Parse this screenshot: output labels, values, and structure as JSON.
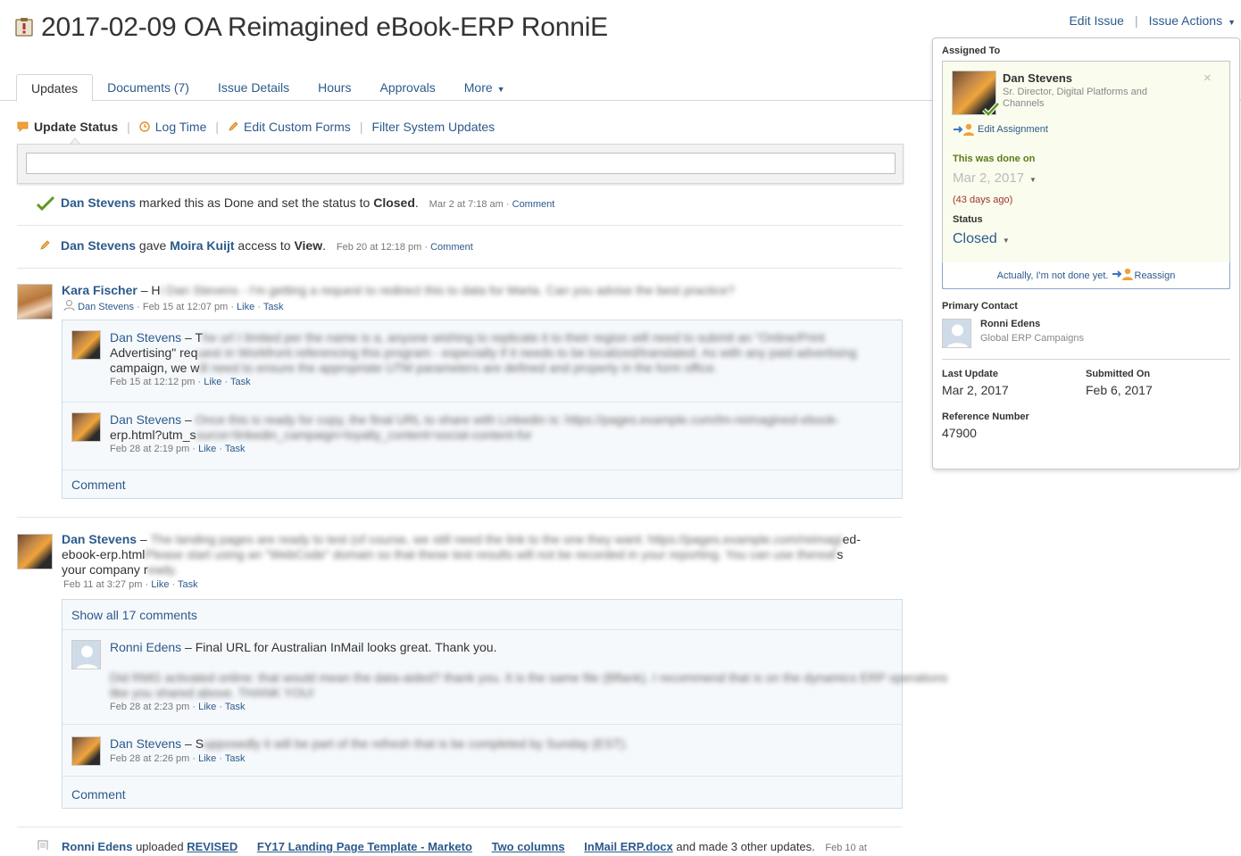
{
  "header": {
    "title": "2017-02-09 OA Reimagined eBook-ERP RonniE",
    "edit_issue": "Edit Issue",
    "separator": "|",
    "issue_actions": "Issue Actions",
    "title_icon": "clipboard-icon"
  },
  "tabs": [
    {
      "label": "Updates",
      "active": true
    },
    {
      "label": "Documents (7)"
    },
    {
      "label": "Issue Details"
    },
    {
      "label": "Hours"
    },
    {
      "label": "Approvals"
    },
    {
      "label": "More"
    }
  ],
  "action_bar": {
    "update_status": "Update Status",
    "log_time": "Log Time",
    "edit_custom_forms": "Edit Custom Forms",
    "filter_system_updates": "Filter System Updates",
    "sep": "|"
  },
  "update_input": {
    "value": "",
    "placeholder": ""
  },
  "feed": {
    "sys1": {
      "actor": "Dan Stevens",
      "text1": " marked this as Done and set the status to ",
      "status": "Closed",
      "text2": ".",
      "time": "Mar 2 at 7:18 am",
      "dot": "·",
      "comment": "Comment"
    },
    "sys2": {
      "actor": "Dan Stevens",
      "text1": " gave ",
      "target": "Moira Kuijt",
      "text2": " access to ",
      "level": "View",
      "text3": ".",
      "time": "Feb 20 at 12:18 pm",
      "dot": "·",
      "comment": "Comment"
    },
    "post1": {
      "author": "Kara Fischer",
      "dash": " – ",
      "text_visible": "H",
      "text_blurred": "i Dan Stevens - I'm getting a request to redirect this to data for Marta. Can you advise the best practice?",
      "recipient": "Dan Stevens",
      "time": "Feb 15 at 12:07 pm",
      "dot": "·",
      "like": "Like",
      "task": "Task",
      "replies": [
        {
          "author": "Dan Stevens",
          "dash": " – ",
          "line1_visible": "T",
          "line1_blurred": "he url I limited per the name is a, anyone wishing to replicate it to their region will need to submit an \"Online/Print",
          "line2_visible": "Advertising\" req",
          "line2_blurred": "uest in Workfront referencing this program - especially if it needs to be localized/translated. As with any paid advertising",
          "line3_visible": "campaign, we w",
          "line3_blurred": "ill need to ensure the appropriate UTM parameters are defined and properly in the form office.",
          "time": "Feb 15 at 12:12 pm",
          "dot": "·",
          "like": "Like",
          "task": "Task"
        },
        {
          "author": "Dan Stevens",
          "dash": " – ",
          "line1_blurred": "Once this is ready for copy, the final URL to share with Linkedin is: https://pages.example.com/lm-reimagined-ebook-",
          "line2_visible": "erp.html?utm_s",
          "line2_blurred": "ource=linkedin_campaign=loyalty_content=social-content-for",
          "time": "Feb 28 at 2:19 pm",
          "dot": "·",
          "like": "Like",
          "task": "Task"
        }
      ],
      "comment": "Comment"
    },
    "post2": {
      "author": "Dan Stevens",
      "dash": " – ",
      "line1_blurred": "The landing pages are ready to test (of course, we still need the link to the one they want: https://pages.example.com/reimagin",
      "line1_end": "ed-",
      "line2_visible": "ebook-erp.html",
      "line2_blurred": " Please start using an \"WebCode\" domain so that these test results will not be recorded in your reporting. You can use thereafter a",
      "line2_end": "s",
      "line3_visible": "your company r",
      "line3_blurred": "eady.",
      "time": "Feb 11 at 3:27 pm",
      "dot": "·",
      "like": "Like",
      "task": "Task",
      "show_all": "Show all 17 comments",
      "replies": [
        {
          "author": "Ronni Edens",
          "dash": " – ",
          "text": "Final URL for Australian InMail looks great. Thank you.",
          "line2_blurred": "Did RMG activated online: that would mean the data-aided? thank you. It is the same file (Bflank). I recommend that is on the dynamics ERP operations",
          "line3_blurred": "like you shared above. THANK YOU!",
          "time": "Feb 28 at 2:23 pm",
          "dot": "·",
          "like": "Like",
          "task": "Task"
        },
        {
          "author": "Dan Stevens",
          "dash": " – ",
          "text_visible": "S",
          "text_blurred": "upposedly it will be part of the refresh that is be completed by Sunday (EST).",
          "time": "Feb 28 at 2:26 pm",
          "dot": "·",
          "like": "Like",
          "task": "Task"
        }
      ],
      "comment": "Comment"
    },
    "bottom": {
      "actor": "Ronni Edens",
      "text1": " uploaded ",
      "doc1": "REVISED",
      "doc2": "FY17 Landing Page Template - Marketo",
      "doc3": "Two columns",
      "doc4": "InMail ERP.docx",
      "text2": " and made 3 other updates.",
      "time": "Feb 10 at"
    }
  },
  "side_panel": {
    "assigned_to_label": "Assigned To",
    "assignee_name": "Dan Stevens",
    "assignee_title": "Sr. Director, Digital Platforms and Channels",
    "close_glyph": "×",
    "edit_assignment": "Edit Assignment",
    "done_label": "This was done on",
    "done_date": "Mar 2, 2017",
    "days_ago": "(43 days ago)",
    "status_label": "Status",
    "status_value": "Closed",
    "not_done": "Actually, I'm not done yet.",
    "reassign": "Reassign",
    "primary_contact_label": "Primary Contact",
    "contact_name": "Ronni Edens",
    "contact_group": "Global ERP Campaigns",
    "last_update_label": "Last Update",
    "last_update_value": "Mar 2, 2017",
    "submitted_on_label": "Submitted On",
    "submitted_on_value": "Feb 6, 2017",
    "reference_label": "Reference Number",
    "reference_value": "47900"
  },
  "colors": {
    "link": "#2c5a8c",
    "done_green": "#5a7a1a",
    "days_ago_red": "#a0342a",
    "assigned_bg": "#fafdee"
  }
}
